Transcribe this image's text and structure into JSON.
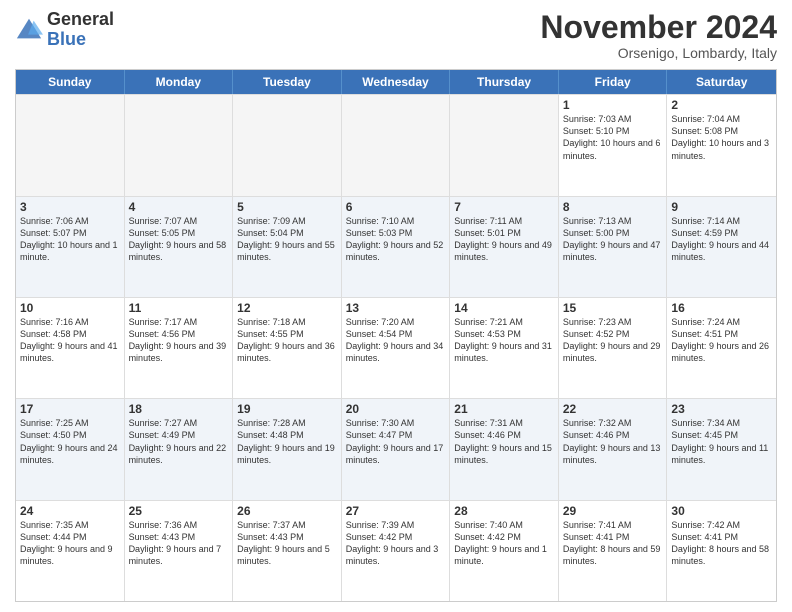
{
  "logo": {
    "line1": "General",
    "line2": "Blue"
  },
  "title": "November 2024",
  "location": "Orsenigo, Lombardy, Italy",
  "days_header": [
    "Sunday",
    "Monday",
    "Tuesday",
    "Wednesday",
    "Thursday",
    "Friday",
    "Saturday"
  ],
  "weeks": [
    [
      {
        "day": "",
        "info": ""
      },
      {
        "day": "",
        "info": ""
      },
      {
        "day": "",
        "info": ""
      },
      {
        "day": "",
        "info": ""
      },
      {
        "day": "",
        "info": ""
      },
      {
        "day": "1",
        "info": "Sunrise: 7:03 AM\nSunset: 5:10 PM\nDaylight: 10 hours and 6 minutes."
      },
      {
        "day": "2",
        "info": "Sunrise: 7:04 AM\nSunset: 5:08 PM\nDaylight: 10 hours and 3 minutes."
      }
    ],
    [
      {
        "day": "3",
        "info": "Sunrise: 7:06 AM\nSunset: 5:07 PM\nDaylight: 10 hours and 1 minute."
      },
      {
        "day": "4",
        "info": "Sunrise: 7:07 AM\nSunset: 5:05 PM\nDaylight: 9 hours and 58 minutes."
      },
      {
        "day": "5",
        "info": "Sunrise: 7:09 AM\nSunset: 5:04 PM\nDaylight: 9 hours and 55 minutes."
      },
      {
        "day": "6",
        "info": "Sunrise: 7:10 AM\nSunset: 5:03 PM\nDaylight: 9 hours and 52 minutes."
      },
      {
        "day": "7",
        "info": "Sunrise: 7:11 AM\nSunset: 5:01 PM\nDaylight: 9 hours and 49 minutes."
      },
      {
        "day": "8",
        "info": "Sunrise: 7:13 AM\nSunset: 5:00 PM\nDaylight: 9 hours and 47 minutes."
      },
      {
        "day": "9",
        "info": "Sunrise: 7:14 AM\nSunset: 4:59 PM\nDaylight: 9 hours and 44 minutes."
      }
    ],
    [
      {
        "day": "10",
        "info": "Sunrise: 7:16 AM\nSunset: 4:58 PM\nDaylight: 9 hours and 41 minutes."
      },
      {
        "day": "11",
        "info": "Sunrise: 7:17 AM\nSunset: 4:56 PM\nDaylight: 9 hours and 39 minutes."
      },
      {
        "day": "12",
        "info": "Sunrise: 7:18 AM\nSunset: 4:55 PM\nDaylight: 9 hours and 36 minutes."
      },
      {
        "day": "13",
        "info": "Sunrise: 7:20 AM\nSunset: 4:54 PM\nDaylight: 9 hours and 34 minutes."
      },
      {
        "day": "14",
        "info": "Sunrise: 7:21 AM\nSunset: 4:53 PM\nDaylight: 9 hours and 31 minutes."
      },
      {
        "day": "15",
        "info": "Sunrise: 7:23 AM\nSunset: 4:52 PM\nDaylight: 9 hours and 29 minutes."
      },
      {
        "day": "16",
        "info": "Sunrise: 7:24 AM\nSunset: 4:51 PM\nDaylight: 9 hours and 26 minutes."
      }
    ],
    [
      {
        "day": "17",
        "info": "Sunrise: 7:25 AM\nSunset: 4:50 PM\nDaylight: 9 hours and 24 minutes."
      },
      {
        "day": "18",
        "info": "Sunrise: 7:27 AM\nSunset: 4:49 PM\nDaylight: 9 hours and 22 minutes."
      },
      {
        "day": "19",
        "info": "Sunrise: 7:28 AM\nSunset: 4:48 PM\nDaylight: 9 hours and 19 minutes."
      },
      {
        "day": "20",
        "info": "Sunrise: 7:30 AM\nSunset: 4:47 PM\nDaylight: 9 hours and 17 minutes."
      },
      {
        "day": "21",
        "info": "Sunrise: 7:31 AM\nSunset: 4:46 PM\nDaylight: 9 hours and 15 minutes."
      },
      {
        "day": "22",
        "info": "Sunrise: 7:32 AM\nSunset: 4:46 PM\nDaylight: 9 hours and 13 minutes."
      },
      {
        "day": "23",
        "info": "Sunrise: 7:34 AM\nSunset: 4:45 PM\nDaylight: 9 hours and 11 minutes."
      }
    ],
    [
      {
        "day": "24",
        "info": "Sunrise: 7:35 AM\nSunset: 4:44 PM\nDaylight: 9 hours and 9 minutes."
      },
      {
        "day": "25",
        "info": "Sunrise: 7:36 AM\nSunset: 4:43 PM\nDaylight: 9 hours and 7 minutes."
      },
      {
        "day": "26",
        "info": "Sunrise: 7:37 AM\nSunset: 4:43 PM\nDaylight: 9 hours and 5 minutes."
      },
      {
        "day": "27",
        "info": "Sunrise: 7:39 AM\nSunset: 4:42 PM\nDaylight: 9 hours and 3 minutes."
      },
      {
        "day": "28",
        "info": "Sunrise: 7:40 AM\nSunset: 4:42 PM\nDaylight: 9 hours and 1 minute."
      },
      {
        "day": "29",
        "info": "Sunrise: 7:41 AM\nSunset: 4:41 PM\nDaylight: 8 hours and 59 minutes."
      },
      {
        "day": "30",
        "info": "Sunrise: 7:42 AM\nSunset: 4:41 PM\nDaylight: 8 hours and 58 minutes."
      }
    ]
  ]
}
